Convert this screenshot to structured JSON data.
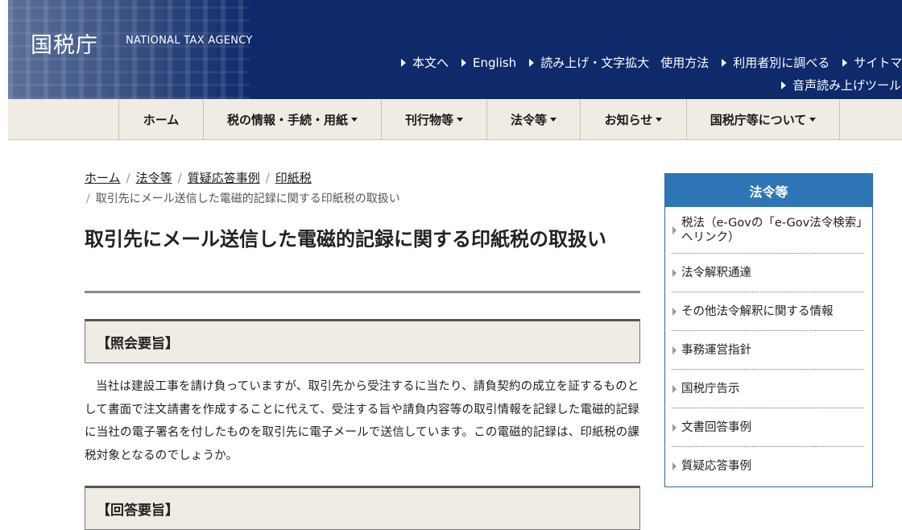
{
  "header": {
    "logo": "国税庁",
    "logo_en": "NATIONAL TAX AGENCY",
    "nav_row1": [
      "本文へ",
      "English",
      "読み上げ・文字拡大",
      "使用方法",
      "利用者別に調べる",
      "サイトマ"
    ],
    "nav_row2": [
      "音声読み上げツール"
    ],
    "bg_color": "#0f2a6b"
  },
  "global_nav": {
    "items": [
      "ホーム",
      "税の情報・手続・用紙",
      "刊行物等",
      "法令等",
      "お知らせ",
      "国税庁等について"
    ],
    "bg_color": "#f0ebe3"
  },
  "breadcrumb": {
    "links": [
      "ホーム",
      "法令等",
      "質疑応答事例",
      "印紙税"
    ],
    "current": "取引先にメール送信した電磁的記録に関する印紙税の取扱い"
  },
  "main": {
    "title": "取引先にメール送信した電磁的記録に関する印紙税の取扱い",
    "inquiry_heading": "【照会要旨】",
    "inquiry_body": "当社は建設工事を請け負っていますが、取引先から受注するに当たり、請負契約の成立を証するものとして書面で注文請書を作成することに代えて、受注する旨や請負内容等の取引情報を記録した電磁的記録に当社の電子署名を付したものを取引先に電子メールで送信しています。この電磁的記録は、印紙税の課税対象となるのでしょうか。",
    "answer_heading": "【回答要旨】"
  },
  "sidebar": {
    "title": "法令等",
    "items": [
      "税法（e-Govの「e-Gov法令検索」へリンク）",
      "法令解釈通達",
      "その他法令解釈に関する情報",
      "事務運営指針",
      "国税庁告示",
      "文書回答事例",
      "質疑応答事例"
    ],
    "accent_color": "#2e75b6"
  }
}
